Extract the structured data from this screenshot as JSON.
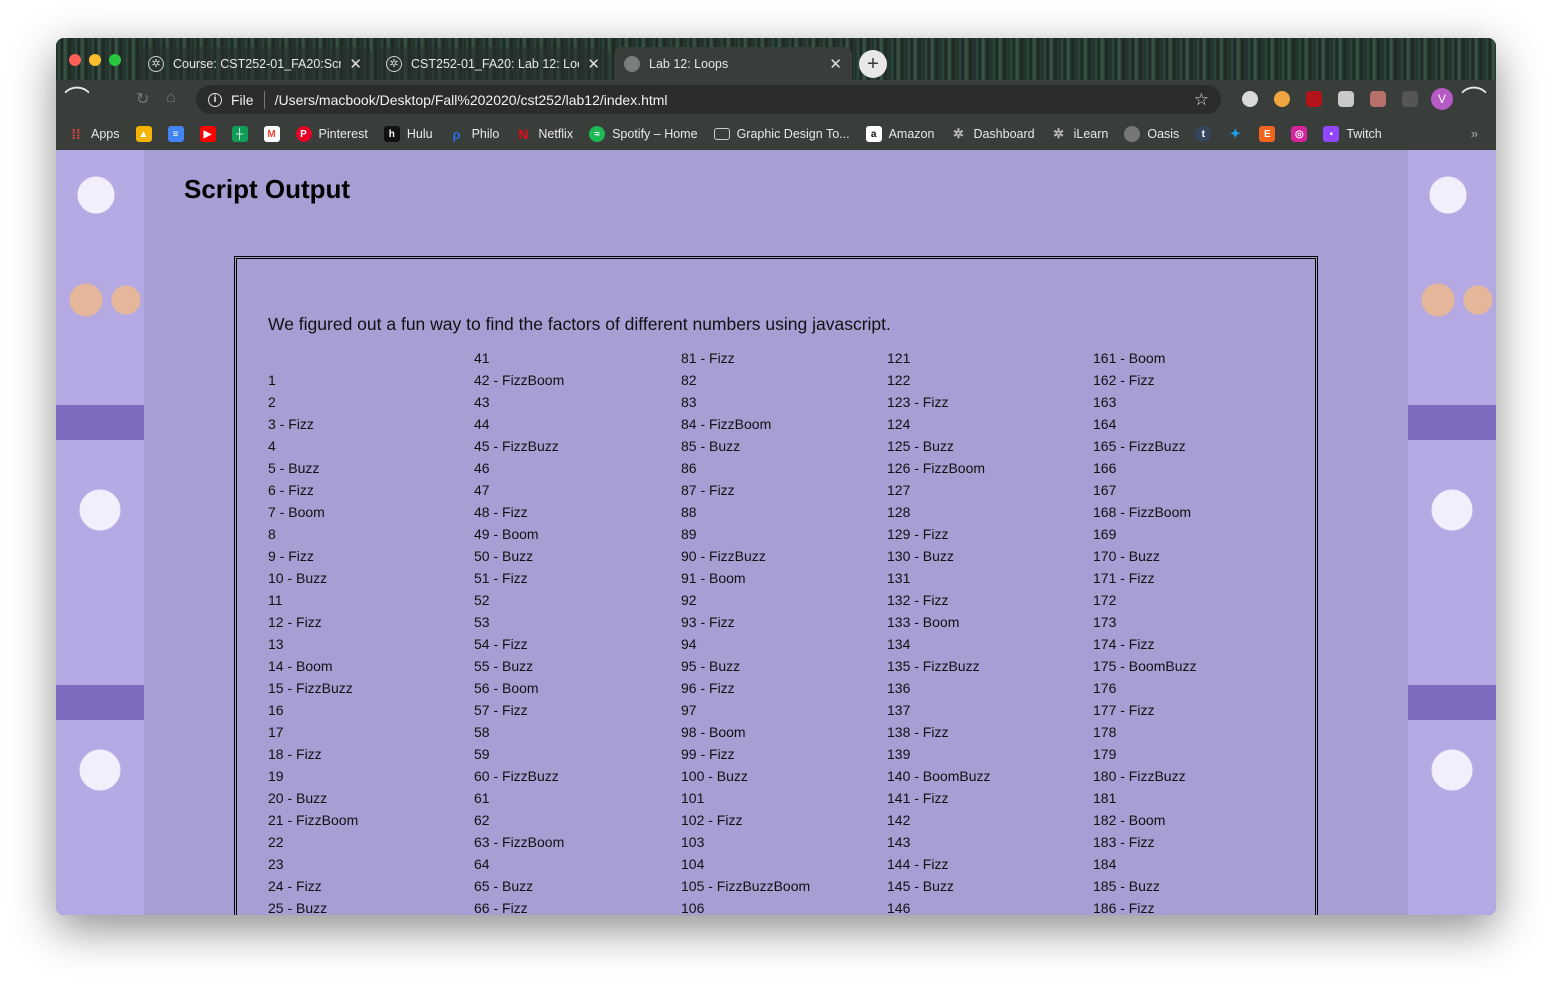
{
  "browser": {
    "tabs": [
      {
        "title": "Course: CST252-01_FA20:Scri",
        "active": false,
        "icon": "gear-icon"
      },
      {
        "title": "CST252-01_FA20: Lab 12: Loo",
        "active": false,
        "icon": "gear-icon"
      },
      {
        "title": "Lab 12: Loops",
        "active": true,
        "icon": "globe-icon"
      }
    ],
    "address": {
      "scheme": "File",
      "url": "/Users/macbook/Desktop/Fall%202020/cst252/lab12/index.html"
    },
    "avatar_letter": "V",
    "bookmarks": [
      {
        "label": "Apps",
        "icon": "apps-grid-icon",
        "color": "#e8453c"
      },
      {
        "label": "",
        "icon": "google-drive-icon",
        "color": "#f5b400"
      },
      {
        "label": "",
        "icon": "google-docs-icon",
        "color": "#4285f4"
      },
      {
        "label": "",
        "icon": "youtube-icon",
        "color": "#ff0000"
      },
      {
        "label": "",
        "icon": "google-sheets-icon",
        "color": "#0f9d58"
      },
      {
        "label": "",
        "icon": "gmail-icon",
        "color": "#ea4335"
      },
      {
        "label": "Pinterest",
        "icon": "pinterest-icon",
        "color": "#e60023"
      },
      {
        "label": "Hulu",
        "icon": "hulu-icon",
        "color": "#111111"
      },
      {
        "label": "Philo",
        "icon": "philo-icon",
        "color": "#2c6be8"
      },
      {
        "label": "Netflix",
        "icon": "netflix-icon",
        "color": "#e50914"
      },
      {
        "label": "Spotify – Home",
        "icon": "spotify-icon",
        "color": "#1db954"
      },
      {
        "label": "Graphic Design To...",
        "icon": "folder-icon",
        "color": "#cccccc"
      },
      {
        "label": "Amazon",
        "icon": "amazon-icon",
        "color": "#ffffff"
      },
      {
        "label": "Dashboard",
        "icon": "gear-icon",
        "color": "#999999"
      },
      {
        "label": "iLearn",
        "icon": "gear-icon",
        "color": "#999999"
      },
      {
        "label": "Oasis",
        "icon": "globe-icon",
        "color": "#777777"
      },
      {
        "label": "",
        "icon": "tumblr-icon",
        "color": "#36465d"
      },
      {
        "label": "",
        "icon": "twitter-icon",
        "color": "#1da1f2"
      },
      {
        "label": "",
        "icon": "etsy-icon",
        "color": "#f1641e"
      },
      {
        "label": "",
        "icon": "instagram-icon",
        "color": "#d6249f"
      },
      {
        "label": "Twitch",
        "icon": "twitch-icon",
        "color": "#9146ff"
      }
    ]
  },
  "page": {
    "title": "Script Output",
    "intro": "We figured out a fun way to find the factors of different numbers using javascript.",
    "columns": [
      [
        "1",
        "2",
        "3 - Fizz",
        "4",
        "5 - Buzz",
        "6 - Fizz",
        "7 - Boom",
        "8",
        "9 - Fizz",
        "10 - Buzz",
        "11",
        "12 - Fizz",
        "13",
        "14 - Boom",
        "15 - FizzBuzz",
        "16",
        "17",
        "18 - Fizz",
        "19",
        "20 - Buzz",
        "21 - FizzBoom",
        "22",
        "23",
        "24 - Fizz",
        "25 - Buzz"
      ],
      [
        "41",
        "42 - FizzBoom",
        "43",
        "44",
        "45 - FizzBuzz",
        "46",
        "47",
        "48 - Fizz",
        "49 - Boom",
        "50 - Buzz",
        "51 - Fizz",
        "52",
        "53",
        "54 - Fizz",
        "55 - Buzz",
        "56 - Boom",
        "57 - Fizz",
        "58",
        "59",
        "60 - FizzBuzz",
        "61",
        "62",
        "63 - FizzBoom",
        "64",
        "65 - Buzz",
        "66 - Fizz"
      ],
      [
        "81 - Fizz",
        "82",
        "83",
        "84 - FizzBoom",
        "85 - Buzz",
        "86",
        "87 - Fizz",
        "88",
        "89",
        "90 - FizzBuzz",
        "91 - Boom",
        "92",
        "93 - Fizz",
        "94",
        "95 - Buzz",
        "96 - Fizz",
        "97",
        "98 - Boom",
        "99 - Fizz",
        "100 - Buzz",
        "101",
        "102 - Fizz",
        "103",
        "104",
        "105 - FizzBuzzBoom",
        "106"
      ],
      [
        "121",
        "122",
        "123 - Fizz",
        "124",
        "125 - Buzz",
        "126 - FizzBoom",
        "127",
        "128",
        "129 - Fizz",
        "130 - Buzz",
        "131",
        "132 - Fizz",
        "133 - Boom",
        "134",
        "135 - FizzBuzz",
        "136",
        "137",
        "138 - Fizz",
        "139",
        "140 - BoomBuzz",
        "141 - Fizz",
        "142",
        "143",
        "144 - Fizz",
        "145 - Buzz",
        "146"
      ],
      [
        "161 - Boom",
        "162 - Fizz",
        "163",
        "164",
        "165 - FizzBuzz",
        "166",
        "167",
        "168 - FizzBoom",
        "169",
        "170 - Buzz",
        "171 - Fizz",
        "172",
        "173",
        "174 - Fizz",
        "175 - BoomBuzz",
        "176",
        "177 - Fizz",
        "178",
        "179",
        "180 - FizzBuzz",
        "181",
        "182 - Boom",
        "183 - Fizz",
        "184",
        "185 - Buzz",
        "186 - Fizz"
      ]
    ]
  }
}
